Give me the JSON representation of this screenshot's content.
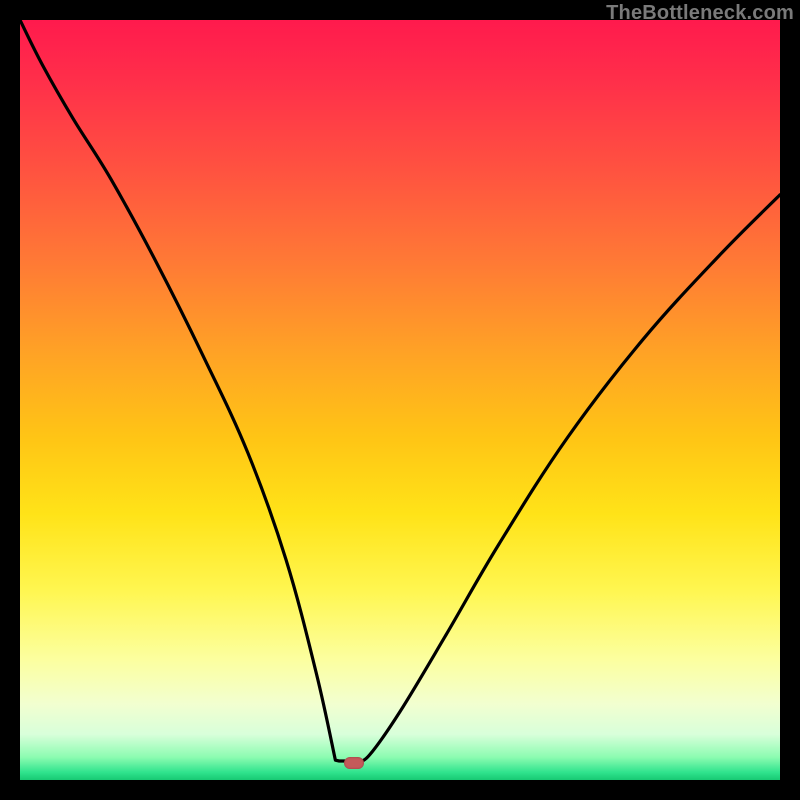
{
  "watermark": "TheBottleneck.com",
  "colors": {
    "curve": "#000000",
    "marker": "#c55a5a",
    "frame": "#000000"
  },
  "chart_data": {
    "type": "line",
    "title": "",
    "xlabel": "",
    "ylabel": "",
    "xlim": [
      0,
      100
    ],
    "ylim": [
      0,
      100
    ],
    "grid": false,
    "legend": false,
    "note": "Values estimated from plot pixels; y expressed as percent of plot height from bottom (0) to top (100).",
    "series": [
      {
        "name": "curve",
        "x": [
          0,
          3,
          7,
          12,
          18,
          24,
          30,
          35,
          39,
          41.5,
          42,
          43.5,
          44.5,
          46,
          50,
          56,
          63,
          72,
          82,
          92,
          100
        ],
        "y": [
          100,
          94,
          87,
          79,
          68,
          56,
          43,
          29,
          14,
          2.6,
          2.5,
          2.5,
          2.5,
          3.3,
          9,
          19,
          31,
          45,
          58,
          69,
          77
        ]
      }
    ],
    "marker": {
      "x": 44,
      "y": 2.3
    },
    "plateau": {
      "x_start": 41.5,
      "x_end": 44.5,
      "y": 2.5
    }
  }
}
